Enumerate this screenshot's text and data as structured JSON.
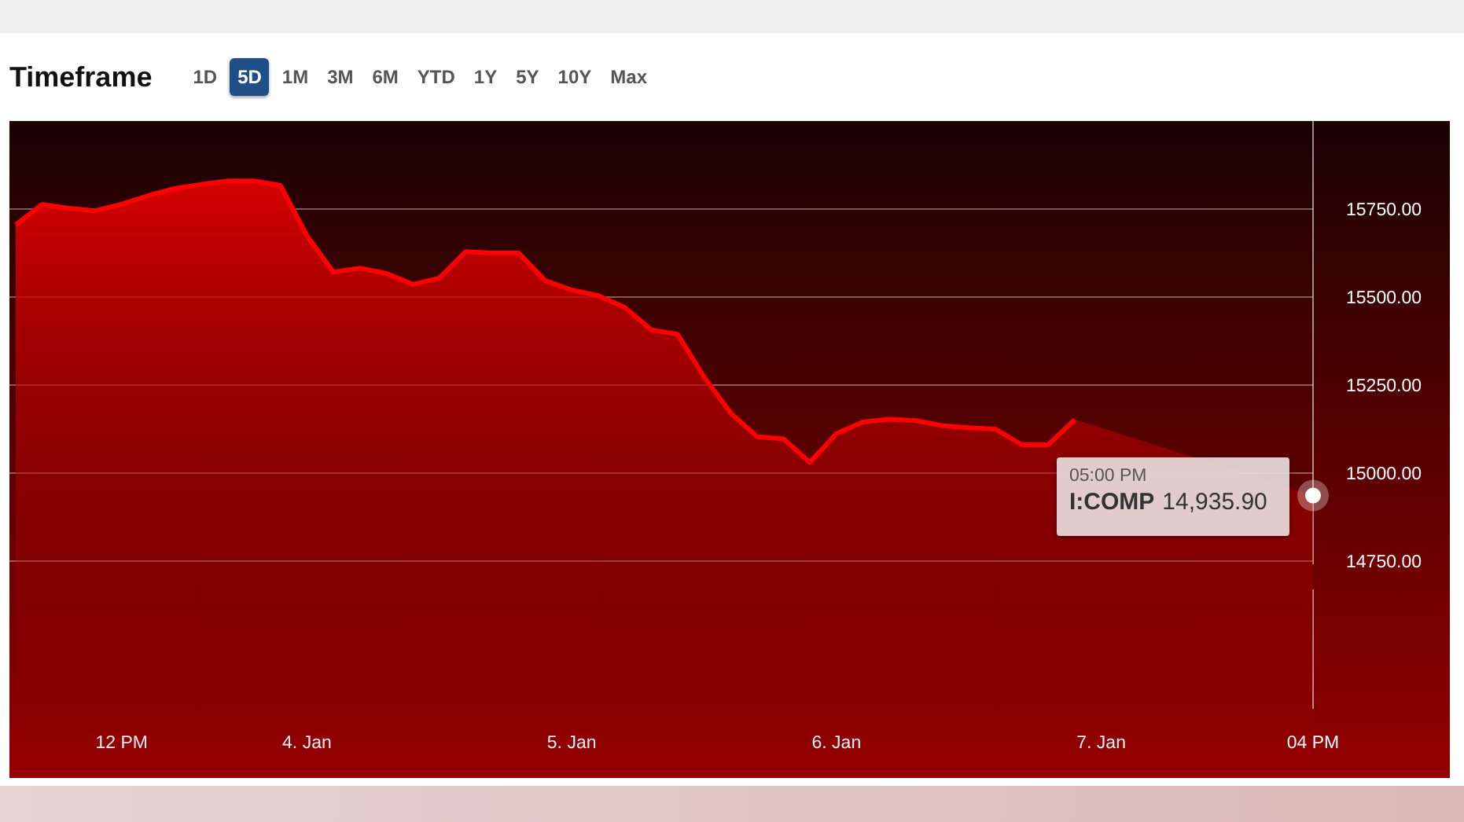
{
  "header": {
    "title": "Timeframe"
  },
  "timeframes": [
    {
      "label": "1D",
      "selected": false
    },
    {
      "label": "5D",
      "selected": true
    },
    {
      "label": "1M",
      "selected": false
    },
    {
      "label": "3M",
      "selected": false
    },
    {
      "label": "6M",
      "selected": false
    },
    {
      "label": "YTD",
      "selected": false
    },
    {
      "label": "1Y",
      "selected": false
    },
    {
      "label": "5Y",
      "selected": false
    },
    {
      "label": "10Y",
      "selected": false
    },
    {
      "label": "Max",
      "selected": false
    }
  ],
  "chart": {
    "chart_data": {
      "type": "area",
      "grid": true,
      "ylim": [
        14330,
        16000
      ],
      "yticks": [
        {
          "value": 14750,
          "label": "14750.00"
        },
        {
          "value": 15000,
          "label": "15000.00"
        },
        {
          "value": 15250,
          "label": "15250.00"
        },
        {
          "value": 15500,
          "label": "15500.00"
        },
        {
          "value": 15750,
          "label": "15750.00"
        }
      ],
      "categories": [
        null,
        null,
        null,
        null,
        "12 PM",
        null,
        null,
        null,
        null,
        null,
        null,
        "4. Jan",
        null,
        null,
        null,
        null,
        null,
        null,
        null,
        null,
        null,
        "5. Jan",
        null,
        null,
        null,
        null,
        null,
        null,
        null,
        null,
        null,
        "6. Jan",
        null,
        null,
        null,
        null,
        null,
        null,
        null,
        null,
        null,
        "7. Jan",
        null,
        null,
        null,
        null,
        null,
        null,
        null,
        "04 PM"
      ],
      "series": [
        {
          "name": "I:COMP",
          "color": "#ff0000",
          "values": [
            15705,
            15763,
            15752,
            15745,
            15764,
            15788,
            15808,
            15820,
            15830,
            15830,
            15817,
            15674,
            15571,
            15582,
            15567,
            15536,
            15554,
            15629,
            15625,
            15625,
            15547,
            15520,
            15504,
            15471,
            15407,
            15394,
            15272,
            15171,
            15103,
            15097,
            15030,
            15112,
            15145,
            15153,
            15149,
            15134,
            15129,
            15125,
            15080,
            15080,
            15152,
            null,
            null,
            null,
            null,
            null,
            null,
            null,
            null,
            14936
          ]
        }
      ]
    },
    "tooltip": {
      "time": "05:00 PM",
      "value": "14,935.90"
    }
  }
}
